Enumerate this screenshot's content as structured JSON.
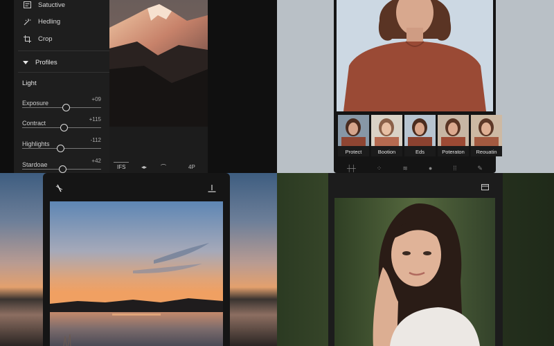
{
  "editor_panel": {
    "tools": [
      {
        "label": "Satuctive",
        "icon": "saturation-icon"
      },
      {
        "label": "Hedling",
        "icon": "healing-icon"
      },
      {
        "label": "Crop",
        "icon": "crop-icon"
      }
    ],
    "profiles_label": "Profiles",
    "section_label": "Light",
    "sliders": [
      {
        "label": "Exposure",
        "value_text": "+09",
        "level": 0.55
      },
      {
        "label": "Contract",
        "value_text": "+115",
        "level": 0.53
      },
      {
        "label": "Highlights",
        "value_text": "-112",
        "level": 0.48
      },
      {
        "label": "Stardoae",
        "value_text": "+42",
        "level": 0.51
      }
    ],
    "bottom_tabs": [
      "IFS",
      "◂▸",
      "⌒",
      "4P"
    ]
  },
  "portrait_presets": {
    "presets": [
      "Protect",
      "Bootion",
      "Eds",
      "Poteraton",
      "Reouatin"
    ],
    "toolbar_icons": [
      "ruler-icon",
      "sparkle-icon",
      "wave-icon",
      "circle-icon",
      "grid-icon",
      "brush-icon"
    ]
  },
  "sunset_editor": {
    "top_left_icon": "no-brush-icon",
    "top_right_icon": "download-icon"
  },
  "portrait_editor": {
    "top_right_icon": "window-icon"
  }
}
